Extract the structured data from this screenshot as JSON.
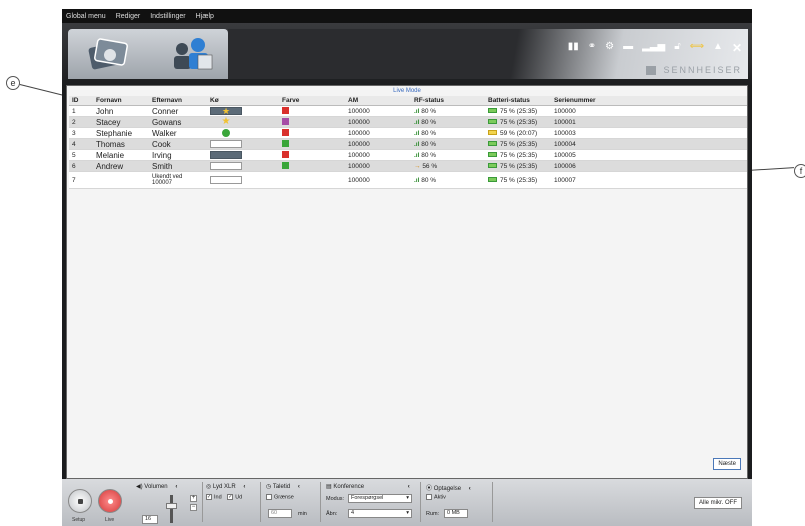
{
  "menu": [
    "Global menu",
    "Rediger",
    "Indstillinger",
    "Hjælp"
  ],
  "brand": "SENNHEISER",
  "callouts": {
    "left": "e",
    "right": "f"
  },
  "mode_title": "Live Mode",
  "columns": [
    "ID",
    "Fornavn",
    "Efternavn",
    "Kø",
    "Farve",
    "AM",
    "RF-status",
    "Batteri-status",
    "Serienummer"
  ],
  "rows": [
    {
      "id": "1",
      "first": "John",
      "last": "Conner",
      "queue": "star-dark",
      "color": "#d9302c",
      "am": "100000",
      "rf": "80 %",
      "batt": "75 % (25:35)",
      "serial": "100000"
    },
    {
      "id": "2",
      "first": "Stacey",
      "last": "Gowans",
      "queue": "star",
      "color": "#a64ca6",
      "am": "100000",
      "rf": "80 %",
      "batt": "75 % (25:35)",
      "serial": "100001"
    },
    {
      "id": "3",
      "first": "Stephanie",
      "last": "Walker",
      "queue": "circle",
      "color": "#d9302c",
      "am": "100000",
      "rf": "80 %",
      "batt": "59 % (20:07)",
      "serial": "100003"
    },
    {
      "id": "4",
      "first": "Thomas",
      "last": "Cook",
      "queue": "empty",
      "color": "#3aa63a",
      "am": "100000",
      "rf": "80 %",
      "batt": "75 % (25:35)",
      "serial": "100004"
    },
    {
      "id": "5",
      "first": "Melanie",
      "last": "Irving",
      "queue": "dark",
      "color": "#d9302c",
      "am": "100000",
      "rf": "80 %",
      "batt": "75 % (25:35)",
      "serial": "100005"
    },
    {
      "id": "6",
      "first": "Andrew",
      "last": "Smith",
      "queue": "empty",
      "color": "#3aa63a",
      "am": "100000",
      "rf": "56 %",
      "batt": "75 % (25:35)",
      "serial": "100006"
    },
    {
      "id": "7",
      "first": "",
      "last": "Ukendt ved 100007",
      "queue": "empty",
      "color": "",
      "am": "100000",
      "rf": "80 %",
      "batt": "75 % (25:35)",
      "serial": "100007"
    }
  ],
  "next_button": "Næste",
  "footer": {
    "setup": "Setup",
    "live": "Live",
    "volume_label": "Volumen",
    "volume_value": "16",
    "lyd_label": "Lyd XLR",
    "ind_label": "Ind",
    "ud_label": "Ud",
    "taletid_label": "Taletid",
    "graense_label": "Grænse",
    "graense_value": "60",
    "min_label": "min",
    "konference_label": "Konference",
    "modus_label": "Modus:",
    "modus_value": "Forespørgsel",
    "abn_label": "Åbn:",
    "abn_value": "4",
    "optagelse_label": "Optagelse",
    "aktiv_label": "Aktiv",
    "rum_label": "Rum:",
    "rum_value": "0 MB",
    "alle_btn": "Alle mikr. OFF"
  }
}
